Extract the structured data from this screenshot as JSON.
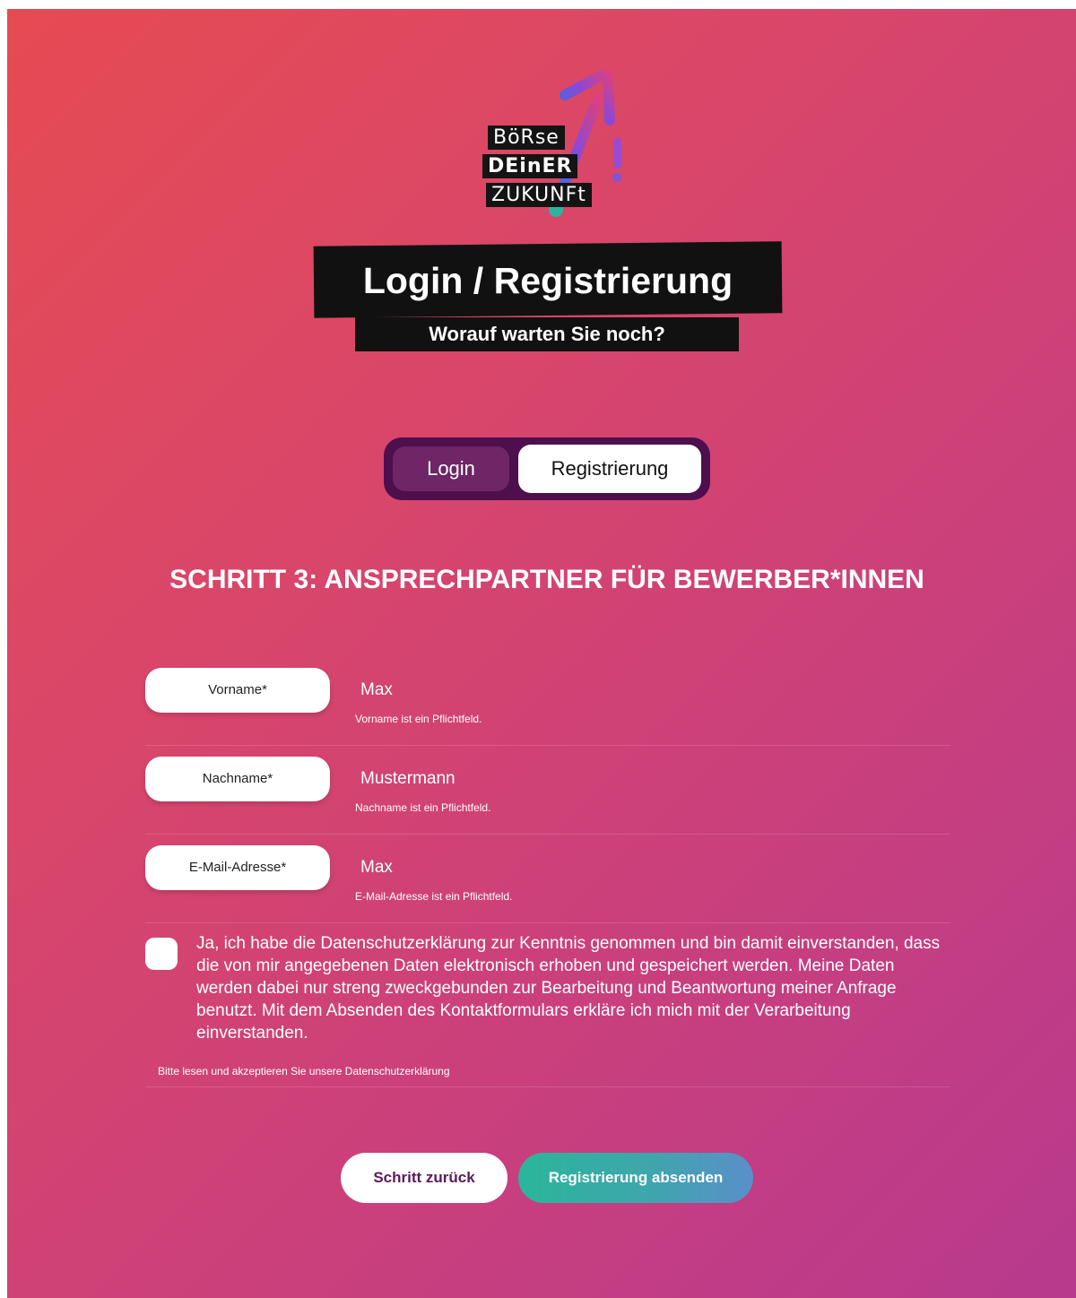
{
  "logo": {
    "line1": "BöRse",
    "line2": "DEinER",
    "line3": "ZUKUNFt"
  },
  "header": {
    "title": "Login / Registrierung",
    "subtitle": "Worauf warten Sie noch?"
  },
  "tabs": {
    "login": "Login",
    "register": "Registrierung",
    "active": "register"
  },
  "step": {
    "heading": "SCHRITT 3: ANSPRECHPARTNER FÜR BEWERBER*INNEN"
  },
  "form": {
    "fields": [
      {
        "label": "Vorname*",
        "value": "Max",
        "error": "Vorname ist ein Pflichtfeld."
      },
      {
        "label": "Nachname*",
        "value": "Mustermann",
        "error": "Nachname ist ein Pflichtfeld."
      },
      {
        "label": "E-Mail-Adresse*",
        "value": "Max",
        "error": "E-Mail-Adresse ist ein Pflichtfeld."
      }
    ],
    "consent": {
      "text": "Ja, ich habe die Datenschutzerklärung zur Kenntnis genommen und bin damit einverstanden, dass die von mir angegebenen Daten elektronisch erhoben und gespeichert werden. Meine Daten werden dabei nur streng zweckgebunden zur Bearbeitung und Beantwortung meiner Anfrage benutzt. Mit dem Absenden des Kontaktformulars erkläre ich mich mit der Verarbeitung einverstanden.",
      "error": "Bitte lesen und akzeptieren Sie unsere Datenschutzerklärung",
      "checked": false
    }
  },
  "buttons": {
    "back": "Schritt zurück",
    "submit": "Registrierung absenden"
  },
  "colors": {
    "gradient_start": "#e64b52",
    "gradient_end": "#b73a8e",
    "toggle_bg": "#4d0f4e",
    "toggle_inactive": "#6e2667",
    "submit_start": "#2bb59b",
    "submit_end": "#5a8fca",
    "back_text": "#5b1a5c"
  }
}
